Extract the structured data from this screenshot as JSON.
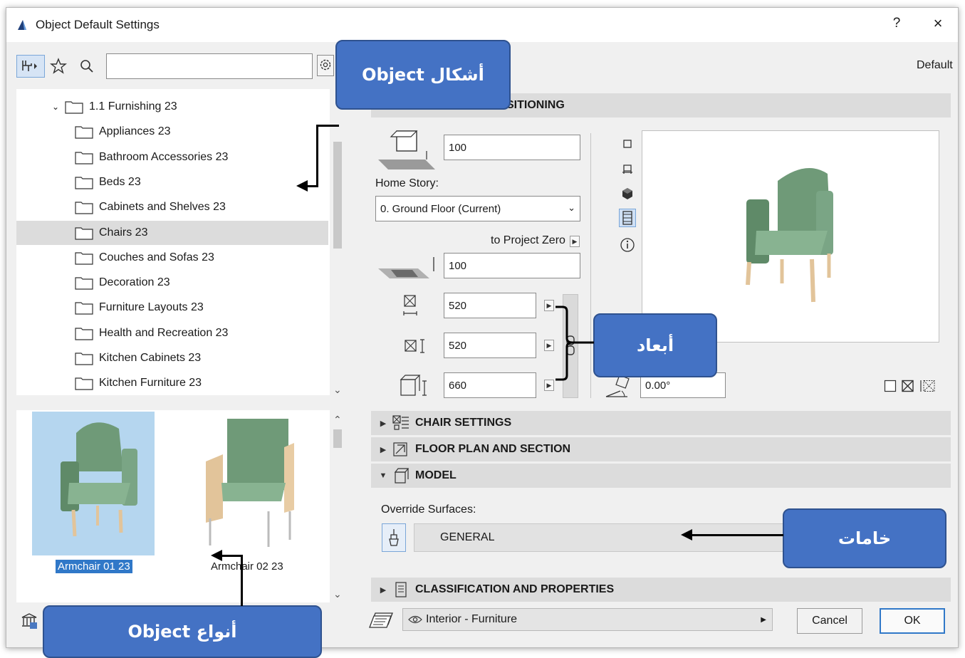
{
  "window": {
    "title": "Object Default Settings",
    "help": "?",
    "close": "×"
  },
  "header": {
    "default_label": "Default"
  },
  "library_tree": {
    "parent": "1.1 Furnishing 23",
    "items": [
      "Appliances 23",
      "Bathroom Accessories 23",
      "Beds 23",
      "Cabinets and Shelves 23",
      "Chairs 23",
      "Couches and Sofas 23",
      "Decoration 23",
      "Furniture Layouts 23",
      "Health and Recreation 23",
      "Kitchen Cabinets 23",
      "Kitchen Furniture 23"
    ],
    "selected": "Chairs 23"
  },
  "objects": [
    {
      "label": "Armchair 01 23",
      "selected": true
    },
    {
      "label": "Armchair 02 23",
      "selected": false
    }
  ],
  "positioning": {
    "section_title": "SITIONING",
    "elevation": "100",
    "home_story_label": "Home Story:",
    "home_story_value": "0. Ground Floor (Current)",
    "to_project_zero_label": "to Project Zero",
    "project_zero_value": "100",
    "width": "520",
    "depth": "520",
    "height": "660",
    "angle": "0.00°"
  },
  "sections": {
    "chair_settings": "CHAIR SETTINGS",
    "floor_plan": "FLOOR PLAN AND SECTION",
    "model": "MODEL",
    "classification": "CLASSIFICATION AND PROPERTIES"
  },
  "model": {
    "override_label": "Override Surfaces:",
    "surface_value": "GENERAL"
  },
  "footer": {
    "layer": "Interior - Furniture",
    "cancel": "Cancel",
    "ok": "OK"
  },
  "callouts": {
    "object_shapes": "أشكال Object",
    "dimensions": "أبعاد",
    "materials": "خامات",
    "object_types": "أنواع  Object"
  },
  "colors": {
    "callout_fill": "#4472c4",
    "selection_blue": "#3078c8",
    "chair_green": "#6f9a78",
    "chair_wood": "#e2c49a"
  }
}
